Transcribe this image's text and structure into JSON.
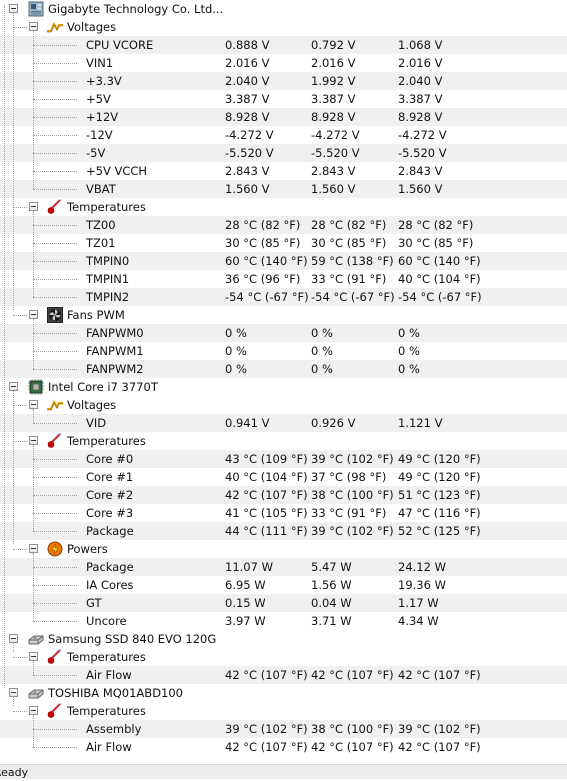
{
  "devices": [
    {
      "name": "Gigabyte Technology Co. Ltd...",
      "icon": "motherboard-icon",
      "groups": [
        {
          "name": "Voltages",
          "icon": "voltage-icon",
          "sensors": [
            {
              "label": "CPU VCORE",
              "value": "0.888 V",
              "min": "0.792 V",
              "max": "1.068 V"
            },
            {
              "label": "VIN1",
              "value": "2.016 V",
              "min": "2.016 V",
              "max": "2.016 V"
            },
            {
              "label": "+3.3V",
              "value": "2.040 V",
              "min": "1.992 V",
              "max": "2.040 V"
            },
            {
              "label": "+5V",
              "value": "3.387 V",
              "min": "3.387 V",
              "max": "3.387 V"
            },
            {
              "label": "+12V",
              "value": "8.928 V",
              "min": "8.928 V",
              "max": "8.928 V"
            },
            {
              "label": "-12V",
              "value": "-4.272 V",
              "min": "-4.272 V",
              "max": "-4.272 V"
            },
            {
              "label": "-5V",
              "value": "-5.520 V",
              "min": "-5.520 V",
              "max": "-5.520 V"
            },
            {
              "label": "+5V VCCH",
              "value": "2.843 V",
              "min": "2.843 V",
              "max": "2.843 V"
            },
            {
              "label": "VBAT",
              "value": "1.560 V",
              "min": "1.560 V",
              "max": "1.560 V"
            }
          ]
        },
        {
          "name": "Temperatures",
          "icon": "thermometer-icon",
          "sensors": [
            {
              "label": "TZ00",
              "value": "28 °C  (82 °F)",
              "min": "28 °C  (82 °F)",
              "max": "28 °C  (82 °F)"
            },
            {
              "label": "TZ01",
              "value": "30 °C  (85 °F)",
              "min": "30 °C  (85 °F)",
              "max": "30 °C  (85 °F)"
            },
            {
              "label": "TMPIN0",
              "value": "60 °C  (140 °F)",
              "min": "59 °C  (138 °F)",
              "max": "60 °C  (140 °F)"
            },
            {
              "label": "TMPIN1",
              "value": "36 °C  (96 °F)",
              "min": "33 °C  (91 °F)",
              "max": "40 °C  (104 °F)"
            },
            {
              "label": "TMPIN2",
              "value": "-54 °C  (-67 °F)",
              "min": "-54 °C  (-67 °F)",
              "max": "-54 °C  (-67 °F)"
            }
          ]
        },
        {
          "name": "Fans PWM",
          "icon": "fan-icon",
          "sensors": [
            {
              "label": "FANPWM0",
              "value": "0 %",
              "min": "0 %",
              "max": "0 %"
            },
            {
              "label": "FANPWM1",
              "value": "0 %",
              "min": "0 %",
              "max": "0 %"
            },
            {
              "label": "FANPWM2",
              "value": "0 %",
              "min": "0 %",
              "max": "0 %"
            }
          ]
        }
      ]
    },
    {
      "name": "Intel Core i7 3770T",
      "icon": "cpu-chip-icon",
      "groups": [
        {
          "name": "Voltages",
          "icon": "voltage-icon",
          "sensors": [
            {
              "label": "VID",
              "value": "0.941 V",
              "min": "0.926 V",
              "max": "1.121 V"
            }
          ]
        },
        {
          "name": "Temperatures",
          "icon": "thermometer-icon",
          "sensors": [
            {
              "label": "Core #0",
              "value": "43 °C  (109 °F)",
              "min": "39 °C  (102 °F)",
              "max": "49 °C  (120 °F)"
            },
            {
              "label": "Core #1",
              "value": "40 °C  (104 °F)",
              "min": "37 °C  (98 °F)",
              "max": "49 °C  (120 °F)"
            },
            {
              "label": "Core #2",
              "value": "42 °C  (107 °F)",
              "min": "38 °C  (100 °F)",
              "max": "51 °C  (123 °F)"
            },
            {
              "label": "Core #3",
              "value": "41 °C  (105 °F)",
              "min": "33 °C  (91 °F)",
              "max": "47 °C  (116 °F)"
            },
            {
              "label": "Package",
              "value": "44 °C  (111 °F)",
              "min": "39 °C  (102 °F)",
              "max": "52 °C  (125 °F)"
            }
          ]
        },
        {
          "name": "Powers",
          "icon": "power-icon",
          "sensors": [
            {
              "label": "Package",
              "value": "11.07 W",
              "min": "5.47 W",
              "max": "24.12 W"
            },
            {
              "label": "IA Cores",
              "value": "6.95 W",
              "min": "1.56 W",
              "max": "19.36 W"
            },
            {
              "label": "GT",
              "value": "0.15 W",
              "min": "0.04 W",
              "max": "1.17 W"
            },
            {
              "label": "Uncore",
              "value": "3.97 W",
              "min": "3.71 W",
              "max": "4.34 W"
            }
          ]
        }
      ]
    },
    {
      "name": "Samsung SSD 840 EVO 120G",
      "icon": "hard-drive-icon",
      "groups": [
        {
          "name": "Temperatures",
          "icon": "thermometer-icon",
          "sensors": [
            {
              "label": "Air Flow",
              "value": "42 °C  (107 °F)",
              "min": "42 °C  (107 °F)",
              "max": "42 °C  (107 °F)"
            }
          ]
        }
      ]
    },
    {
      "name": "TOSHIBA MQ01ABD100",
      "icon": "hard-drive-icon",
      "groups": [
        {
          "name": "Temperatures",
          "icon": "thermometer-icon",
          "sensors": [
            {
              "label": "Assembly",
              "value": "39 °C  (102 °F)",
              "min": "38 °C  (100 °F)",
              "max": "39 °C  (102 °F)"
            },
            {
              "label": "Air Flow",
              "value": "42 °C  (107 °F)",
              "min": "42 °C  (107 °F)",
              "max": "42 °C  (107 °F)"
            }
          ]
        }
      ]
    }
  ],
  "status_bar": {
    "text": "Ready"
  },
  "colors": {
    "stripe": "#f0f0f0",
    "tree_line": "#a0a0a0",
    "status_bg": "#ececec"
  }
}
